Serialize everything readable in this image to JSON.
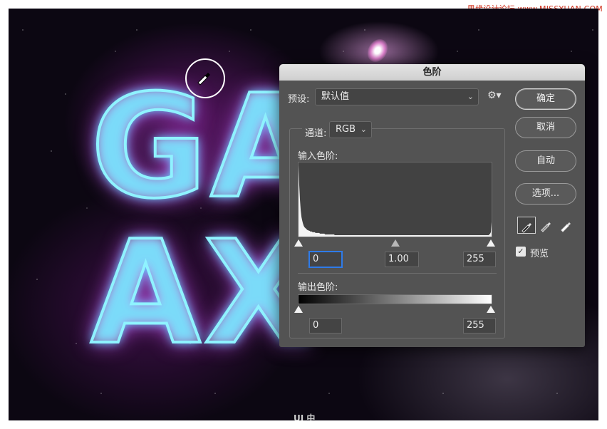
{
  "watermark": "思缘设计论坛 www.MISSYUAN.COM",
  "canvas": {
    "text_line1": "GA",
    "text_line2": "AX",
    "logo": "UI 中"
  },
  "dialog": {
    "title": "色阶",
    "preset_label": "预设:",
    "preset_value": "默认值",
    "channel_label": "通道:",
    "channel_value": "RGB",
    "input_levels_label": "输入色阶:",
    "input_black": "0",
    "input_gamma": "1.00",
    "input_white": "255",
    "output_levels_label": "输出色阶:",
    "output_black": "0",
    "output_white": "255",
    "buttons": {
      "ok": "确定",
      "cancel": "取消",
      "auto": "自动",
      "options": "选项..."
    },
    "preview_label": "预览",
    "preview_checked": true,
    "colors": {
      "dialog_bg": "#535353",
      "focus": "#2f7be8"
    }
  },
  "histogram": [
    98,
    70,
    50,
    36,
    27,
    22,
    18,
    15,
    13,
    12,
    11,
    10,
    9,
    9,
    8,
    8,
    7,
    7,
    7,
    6,
    6,
    6,
    6,
    5,
    5,
    5,
    5,
    5,
    5,
    4,
    4,
    4,
    4,
    4,
    4,
    4,
    3,
    3,
    3,
    3,
    3,
    3,
    3,
    3,
    3,
    3,
    3,
    3,
    3,
    2,
    2,
    2,
    2,
    2,
    2,
    2,
    2,
    2,
    2,
    2,
    2,
    2,
    2,
    2,
    2,
    2,
    2,
    2,
    2,
    2,
    2,
    2,
    2,
    2,
    2,
    2,
    2,
    2,
    2,
    2,
    2,
    2,
    2,
    2,
    2,
    2,
    2,
    2,
    2,
    2,
    2,
    2,
    2,
    2,
    2,
    2,
    2,
    2,
    2,
    2,
    2,
    2,
    2,
    2,
    2,
    2,
    2,
    2,
    2,
    2,
    2,
    2,
    2,
    2,
    2,
    2,
    2,
    2,
    2,
    2,
    2,
    2,
    2,
    2,
    2,
    2,
    2,
    2,
    2,
    2,
    2,
    2,
    2,
    2,
    2,
    2,
    2,
    2,
    2,
    2,
    2,
    2,
    2,
    2,
    2,
    2,
    2,
    2,
    2,
    2,
    2,
    2,
    2,
    2,
    2,
    2,
    2,
    2,
    2,
    2,
    2,
    2,
    2,
    2,
    2,
    2,
    2,
    2,
    2,
    2,
    2,
    2,
    2,
    2,
    2,
    2,
    2,
    2,
    2,
    2,
    2,
    2,
    2,
    2,
    2,
    2,
    2,
    2,
    2,
    2,
    2,
    2,
    2,
    2,
    2,
    2,
    2,
    2,
    2,
    2,
    2,
    2,
    2,
    2,
    2,
    2,
    2,
    2,
    2,
    2,
    2,
    2,
    2,
    2,
    2,
    2,
    2,
    2,
    2,
    2,
    2,
    2,
    2,
    2,
    2,
    2,
    2,
    2,
    2,
    2,
    2,
    2,
    2,
    2,
    2,
    2,
    2,
    2,
    2,
    2,
    2,
    2,
    2,
    2,
    2,
    2,
    2,
    2,
    2,
    2,
    2,
    2,
    2,
    2,
    2,
    2,
    2,
    2,
    3,
    4,
    6,
    20
  ]
}
